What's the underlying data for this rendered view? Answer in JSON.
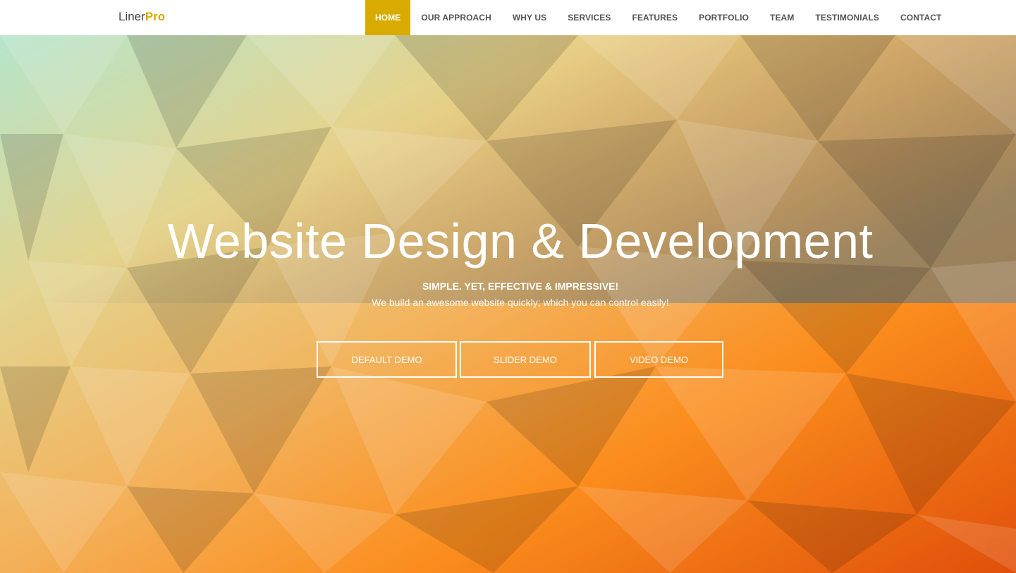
{
  "brand": {
    "name_main": "Liner",
    "name_accent": "Pro",
    "accent_color": "#d9ab00"
  },
  "nav": {
    "items": [
      {
        "label": "HOME",
        "active": true
      },
      {
        "label": "OUR APPROACH",
        "active": false
      },
      {
        "label": "WHY US",
        "active": false
      },
      {
        "label": "SERVICES",
        "active": false
      },
      {
        "label": "FEATURES",
        "active": false
      },
      {
        "label": "PORTFOLIO",
        "active": false
      },
      {
        "label": "TEAM",
        "active": false
      },
      {
        "label": "TESTIMONIALS",
        "active": false
      },
      {
        "label": "CONTACT",
        "active": false
      }
    ]
  },
  "hero": {
    "title": "Website Design & Development",
    "tagline": "SIMPLE. YET, EFFECTIVE & IMPRESSIVE!",
    "subtitle": "We build an awesome website quickly; which you can control easily!",
    "buttons": {
      "default_demo": "DEFAULT DEMO",
      "slider_demo": "SLIDER DEMO",
      "video_demo": "VIDEO DEMO"
    },
    "background": "low-poly gradient, mint to orange"
  }
}
